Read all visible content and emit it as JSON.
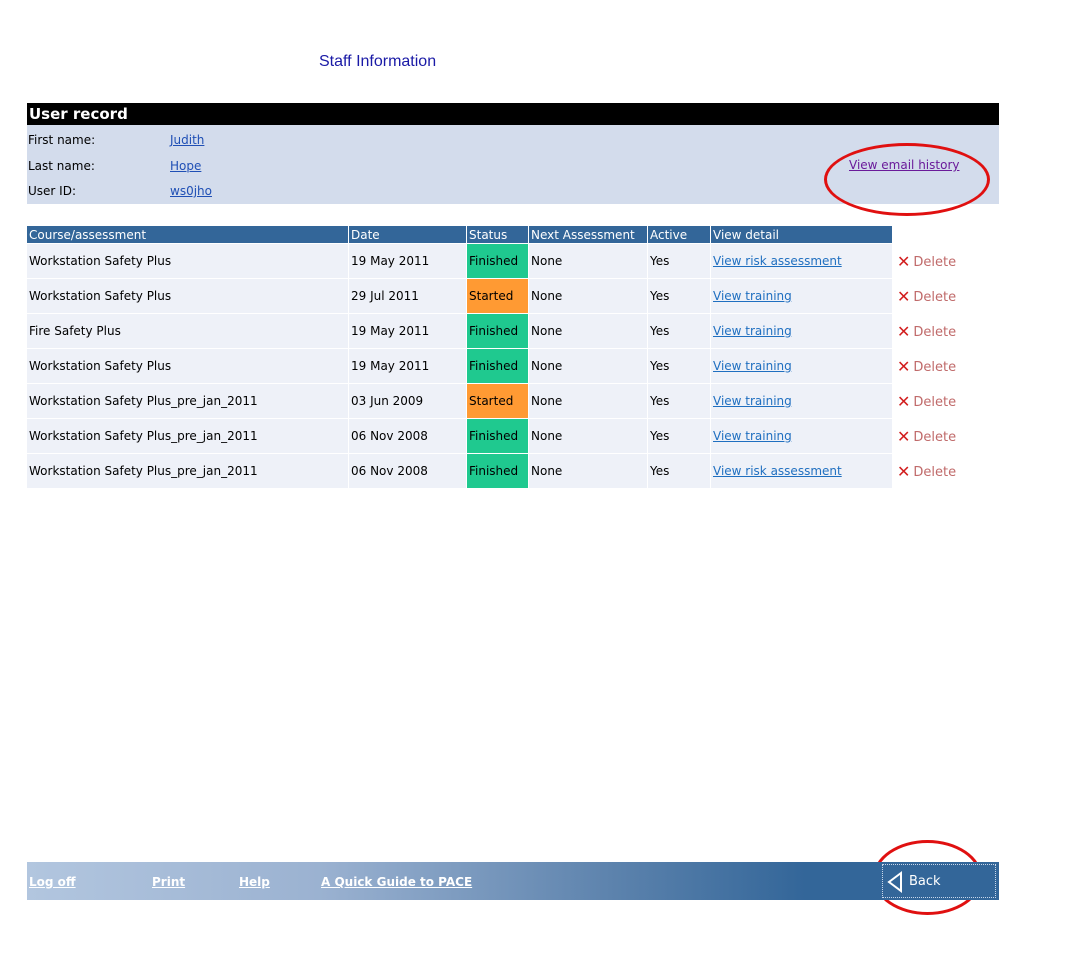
{
  "page_title": "Staff Information",
  "user_record": {
    "heading": "User record",
    "fields": [
      {
        "label": "First name:",
        "value": "Judith"
      },
      {
        "label": "Last name:",
        "value": "Hope"
      },
      {
        "label": "User ID:",
        "value": "ws0jho"
      }
    ],
    "email_history_link": "View email history"
  },
  "table": {
    "headers": [
      "Course/assessment",
      "Date",
      "Status",
      "Next Assessment",
      "Active",
      "View detail"
    ],
    "delete_label": "Delete",
    "rows": [
      {
        "course": "Workstation Safety Plus",
        "date": "19 May 2011",
        "status": "Finished",
        "next": "None",
        "active": "Yes",
        "detail": "View risk assessment"
      },
      {
        "course": "Workstation Safety Plus",
        "date": "29 Jul 2011",
        "status": "Started",
        "next": "None",
        "active": "Yes",
        "detail": "View training"
      },
      {
        "course": "Fire Safety Plus",
        "date": "19 May 2011",
        "status": "Finished",
        "next": "None",
        "active": "Yes",
        "detail": "View training"
      },
      {
        "course": "Workstation Safety Plus",
        "date": "19 May 2011",
        "status": "Finished",
        "next": "None",
        "active": "Yes",
        "detail": "View training"
      },
      {
        "course": "Workstation Safety Plus_pre_jan_2011",
        "date": "03 Jun 2009",
        "status": "Started",
        "next": "None",
        "active": "Yes",
        "detail": "View training"
      },
      {
        "course": "Workstation Safety Plus_pre_jan_2011",
        "date": "06 Nov 2008",
        "status": "Finished",
        "next": "None",
        "active": "Yes",
        "detail": "View training"
      },
      {
        "course": "Workstation Safety Plus_pre_jan_2011",
        "date": "06 Nov 2008",
        "status": "Finished",
        "next": "None",
        "active": "Yes",
        "detail": "View risk assessment"
      }
    ]
  },
  "footer": {
    "links": [
      "Log off",
      "Print",
      "Help",
      "A Quick Guide to PACE"
    ],
    "back_label": "Back"
  },
  "colors": {
    "header_bg": "#336699",
    "finished": "#1fc98f",
    "started": "#ff9a33",
    "annotation_ring": "#e01010"
  },
  "icons": {
    "delete": "x-icon",
    "back": "back-arrow-icon"
  }
}
